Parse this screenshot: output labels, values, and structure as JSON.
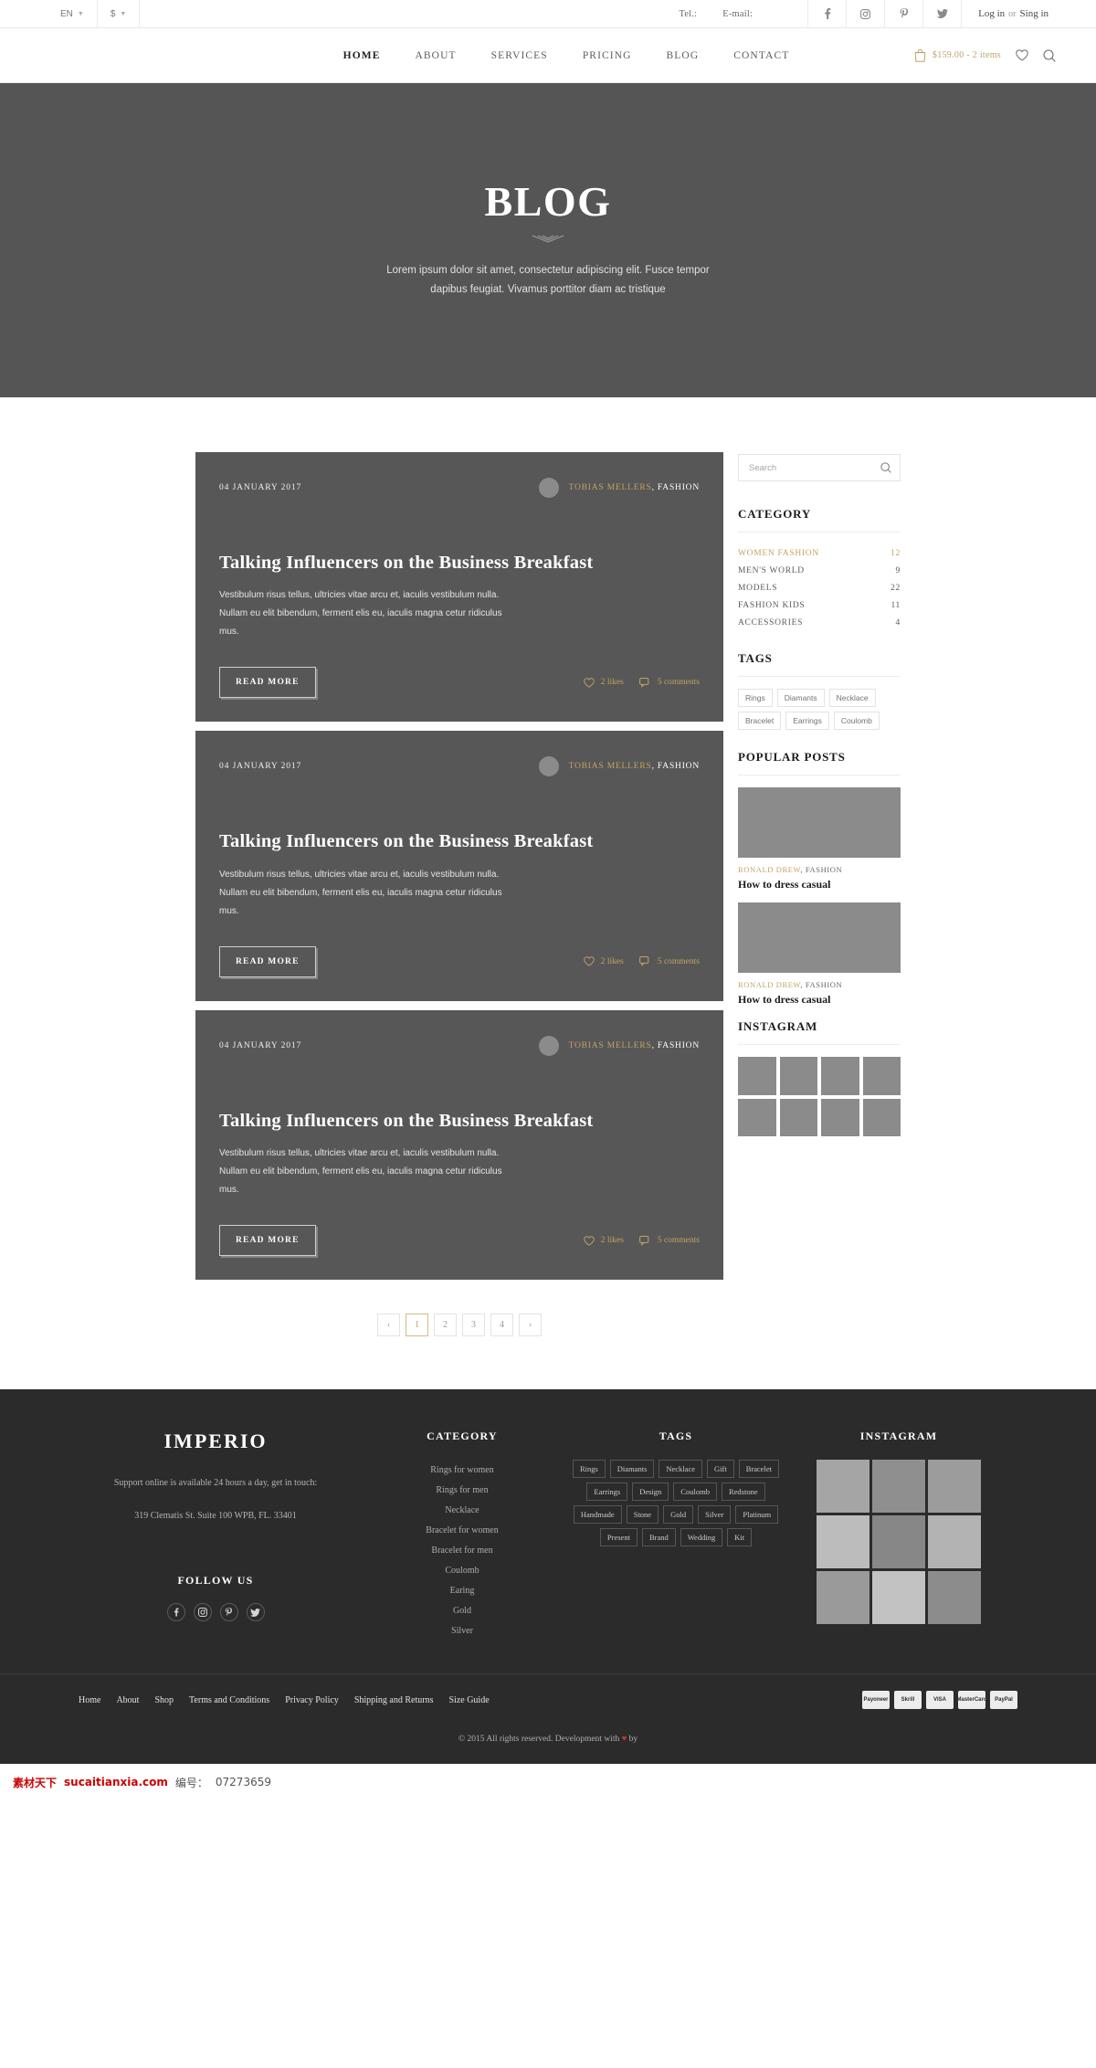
{
  "topbar": {
    "language": "EN",
    "currency": "$",
    "tel_label": "Tel.:",
    "email_label": "E-mail:",
    "social": [
      "facebook-icon",
      "instagram-icon",
      "pinterest-icon",
      "twitter-icon"
    ],
    "login": "Log in",
    "or": "or",
    "signin": "Sing in"
  },
  "header": {
    "nav": [
      {
        "label": "HOME",
        "active": true
      },
      {
        "label": "ABOUT",
        "active": false
      },
      {
        "label": "SERVICES",
        "active": false
      },
      {
        "label": "PRICING",
        "active": false
      },
      {
        "label": "BLOG",
        "active": false
      },
      {
        "label": "CONTACT",
        "active": false
      }
    ],
    "cart_text": "$159.00 - 2 items",
    "wishlist_icon": "heart-icon",
    "search_icon": "search-icon"
  },
  "hero": {
    "title": "BLOG",
    "ornament": "\\\\\\//////",
    "subtitle": "Lorem ipsum dolor sit amet, consectetur adipiscing elit. Fusce tempor dapibus feugiat. Vivamus porttitor diam ac tristique"
  },
  "posts": [
    {
      "date": "04 JANUARY 2017",
      "author": "TOBIAS MELLERS",
      "category": ", FASHION",
      "title": "Talking Influencers on the Business Breakfast",
      "excerpt": "Vestibulum risus tellus, ultricies vitae arcu et, iaculis vestibulum nulla. Nullam eu elit bibendum, ferment elis eu, iaculis magna cetur ridiculus mus.",
      "read_more": "READ MORE",
      "likes": "2 likes",
      "comments": "5 comments"
    },
    {
      "date": "04 JANUARY 2017",
      "author": "TOBIAS MELLERS",
      "category": ", FASHION",
      "title": "Talking Influencers on the Business Breakfast",
      "excerpt": "Vestibulum risus tellus, ultricies vitae arcu et, iaculis vestibulum nulla. Nullam eu elit bibendum, ferment elis eu, iaculis magna cetur ridiculus mus.",
      "read_more": "READ MORE",
      "likes": "2 likes",
      "comments": "5 comments"
    },
    {
      "date": "04 JANUARY 2017",
      "author": "TOBIAS MELLERS",
      "category": ", FASHION",
      "title": "Talking Influencers on the Business Breakfast",
      "excerpt": "Vestibulum risus tellus, ultricies vitae arcu et, iaculis vestibulum nulla. Nullam eu elit bibendum, ferment elis eu, iaculis magna cetur ridiculus mus.",
      "read_more": "READ MORE",
      "likes": "2 likes",
      "comments": "5 comments"
    }
  ],
  "pagination": {
    "prev": "‹",
    "pages": [
      "1",
      "2",
      "3",
      "4"
    ],
    "active": "1",
    "next": "›"
  },
  "sidebar": {
    "search_placeholder": "Search",
    "category_title": "CATEGORY",
    "categories": [
      {
        "label": "WOMEN FASHION",
        "count": "12",
        "active": true
      },
      {
        "label": "MEN'S WORLD",
        "count": "9",
        "active": false
      },
      {
        "label": "MODELS",
        "count": "22",
        "active": false
      },
      {
        "label": "FASHION KIDS",
        "count": "11",
        "active": false
      },
      {
        "label": "ACCESSORIES",
        "count": "4",
        "active": false
      }
    ],
    "tags_title": "TAGS",
    "tags": [
      "Rings",
      "Diamants",
      "Necklace",
      "Bracelet",
      "Earrings",
      "Coulomb"
    ],
    "popular_title": "POPULAR POSTS",
    "popular_posts": [
      {
        "author": "RONALD DREW",
        "category": ", FASHION",
        "title": "How to dress casual"
      },
      {
        "author": "RONALD DREW",
        "category": ", FASHION",
        "title": "How to dress casual"
      }
    ],
    "instagram_title": "INSTAGRAM",
    "instagram_cells": 8
  },
  "footer": {
    "brand": "IMPERIO",
    "support": "Support online is available 24 hours a day, get in touch:",
    "address": "319 Clematis St. Suite 100 WPB, FL. 33401",
    "follow_title": "FOLLOW US",
    "social": [
      "facebook-icon",
      "instagram-icon",
      "pinterest-icon",
      "twitter-icon"
    ],
    "category_title": "CATEGORY",
    "categories": [
      "Rings for women",
      "Rings for men",
      "Necklace",
      "Bracelet for women",
      "Bracelet for men",
      "Coulomb",
      "Earing",
      "Gold",
      "Silver"
    ],
    "tags_title": "TAGS",
    "tags": [
      "Rings",
      "Diamants",
      "Necklace",
      "Gift",
      "Bracelet",
      "Earrings",
      "Design",
      "Coulomb",
      "Redstone",
      "Handmade",
      "Stone",
      "Gold",
      "Silver",
      "Platinum",
      "Present",
      "Brand",
      "Wedding",
      "Kit"
    ],
    "instagram_title": "INSTAGRAM",
    "instagram_cells": 9,
    "bottom_links": [
      "Home",
      "About",
      "Shop",
      "Terms and Conditions",
      "Privacy Policy",
      "Shipping and Returns",
      "Size Guide"
    ],
    "payments": [
      "Payoneer",
      "Skrill",
      "VISA",
      "MasterCard",
      "PayPal"
    ],
    "copyright_pre": "© 2015 All rights reserved. Development with ",
    "copyright_post": " by"
  },
  "watermark": {
    "site": "素材天下",
    "domain": "sucaitianxia.com",
    "code_label": "编号：",
    "code": "07273659"
  },
  "colors": {
    "gold": "#c3a263",
    "hero_bg": "#555555",
    "card_bg": "#575757",
    "footer_bg": "#2b2b2b"
  }
}
